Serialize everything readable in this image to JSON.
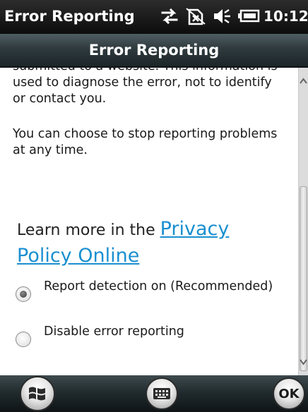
{
  "status_bar": {
    "app_title": "Error Reporting",
    "time": "10:12",
    "icons": [
      "data-connection-icon",
      "no-sim-icon",
      "volume-icon",
      "battery-icon"
    ]
  },
  "title_bar": {
    "title": "Error Reporting"
  },
  "content": {
    "paragraph_cut": "submitted to a website. This information is",
    "paragraph_1": "used to diagnose the error, not to identify or contact you.",
    "paragraph_2": "You can choose to stop reporting problems at any time.",
    "learn_more_prefix": "Learn more in the ",
    "learn_more_link": "Privacy Policy Online",
    "options": [
      {
        "label": "Report detection on (Recommended)",
        "selected": true
      },
      {
        "label": "Disable error reporting",
        "selected": false
      }
    ]
  },
  "bottom_bar": {
    "start_icon": "windows-logo-icon",
    "keyboard_icon": "keyboard-icon",
    "ok_label": "OK"
  },
  "colors": {
    "link": "#1a8fd0",
    "bar_dark": "#1c2528",
    "text": "#1a1a1a"
  }
}
